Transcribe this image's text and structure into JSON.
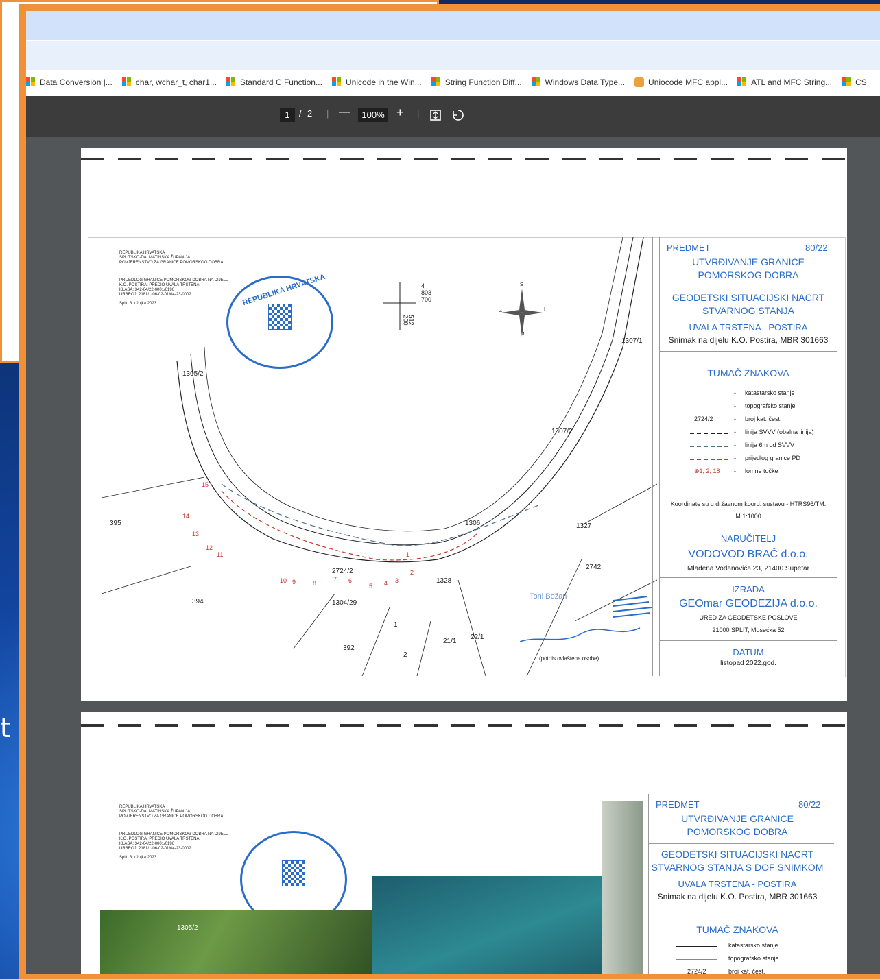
{
  "bookmarks": [
    {
      "label": "Data Conversion |...",
      "icon": "ms-logo"
    },
    {
      "label": "char, wchar_t, char1...",
      "icon": "ms-logo"
    },
    {
      "label": "Standard C Function...",
      "icon": "ms-logo"
    },
    {
      "label": "Unicode in the Win...",
      "icon": "ms-logo"
    },
    {
      "label": "String Function Diff...",
      "icon": "ms-logo"
    },
    {
      "label": "Windows Data Type...",
      "icon": "ms-logo"
    },
    {
      "label": "Uniocode MFC appl...",
      "icon": "site-icon"
    },
    {
      "label": "ATL and MFC String...",
      "icon": "ms-logo"
    },
    {
      "label": "CS",
      "icon": "ms-logo"
    }
  ],
  "pdf_toolbar": {
    "current_page": "1",
    "page_sep": "/",
    "total_pages": "2",
    "zoom": "100%",
    "minus": "—",
    "plus": "+"
  },
  "background_text": "t",
  "page1": {
    "header_left": [
      "REPUBLIKA HRVATSKA",
      "SPLITSKO-DALMATINSKA ŽUPANIJA",
      "POVJERENSTVO ZA GRANICE POMORSKOG DOBRA"
    ],
    "header_prop": [
      "PRIJEDLOG GRANICE POMORSKOG DOBRA NA DIJELU",
      "K.O. POSTIRA, PREDIO UVALA TRSTENA"
    ],
    "klasa": "KLASA: 342-04/22-0001/0196",
    "urbroj": "URBROJ: 2181/1-06-02-01/04-23-0002",
    "date_place": "Split, 3. ožujka 2023.",
    "stamp_text": "REPUBLIKA HRVATSKA",
    "coord_top": "4",
    "coord_a": "803",
    "coord_b": "700",
    "coord_c": "512",
    "coord_d": "200",
    "predmet": "PREDMET",
    "predmet_no": "80/22",
    "title1": "UTVRĐIVANJE GRANICE",
    "title2": "POMORSKOG DOBRA",
    "title3": "GEODETSKI SITUACIJSKI NACRT",
    "title4": "STVARNOG STANJA",
    "place": "UVALA TRSTENA - POSTIRA",
    "snimak": "Snimak na dijelu K.O. Postira, MBR 301663",
    "tumac": "TUMAČ ZNAKOVA",
    "legend": [
      {
        "label": "katastarsko stanje",
        "key": "",
        "color": "#222222",
        "style": "solid"
      },
      {
        "label": "topografsko stanje",
        "key": "",
        "color": "#888888",
        "style": "solid"
      },
      {
        "label": "broj kat. čest.",
        "key": "2724/2",
        "color": "",
        "style": "text"
      },
      {
        "label": "linija SVVV (obalna linija)",
        "key": "",
        "color": "#222222",
        "style": "dashed"
      },
      {
        "label": "linija 6m od SVVV",
        "key": "",
        "color": "#4a6f8a",
        "style": "dashed"
      },
      {
        "label": "prijedlog granice PD",
        "key": "",
        "color": "#c0392b",
        "style": "dashed"
      },
      {
        "label": "lomne točke",
        "key": "⊕1, 2, 18",
        "color": "#c0392b",
        "style": "text"
      }
    ],
    "koord": "Koordinate su u državnom koord. sustavu - HTRS96/TM.",
    "scale": "M 1:1000",
    "narucitelj": "NARUČITELJ",
    "vodovod": "VODOVOD BRAČ d.o.o.",
    "vod_addr": "Mladena Vodanovića 23, 21400 Supetar",
    "izrada": "IZRADA",
    "geomar": "GEOmar GEODEZIJA d.o.o.",
    "ured": "URED ZA GEODETSKE POSLOVE",
    "geo_addr": "21000 SPLIT, Mosećka 52",
    "datum": "DATUM",
    "datum_val": "listopad 2022.god.",
    "signer": "Toni Božan",
    "signature_caption": "(potpis ovlaštene osobe)",
    "parcels": [
      "1305/2",
      "1307/1",
      "1307/2",
      "2724/2",
      "1306",
      "1327",
      "2742",
      "395",
      "394",
      "1304/29",
      "1328",
      "1",
      "2",
      "392",
      "21/1",
      "22/1"
    ],
    "points": [
      "1",
      "2",
      "3",
      "4",
      "5",
      "6",
      "7",
      "8",
      "9",
      "10",
      "11",
      "12",
      "13",
      "14",
      "15"
    ],
    "compass": [
      "S",
      "I",
      "J",
      "Z"
    ]
  },
  "page2": {
    "header_left": [
      "REPUBLIKA HRVATSKA",
      "SPLITSKO-DALMATINSKA ŽUPANIJA",
      "POVJERENSTVO ZA GRANICE POMORSKOG DOBRA"
    ],
    "header_prop": [
      "PRIJEDLOG GRANICE POMORSKOG DOBRA NA DIJELU",
      "K.O. POSTIRA, PREDIO UVALA TRSTENA"
    ],
    "klasa": "KLASA: 342-04/22-0001/0196",
    "urbroj": "URBROJ: 2181/1-06-02-01/04-23-0002",
    "date_place": "Split, 3. ožujka 2023.",
    "predmet": "PREDMET",
    "predmet_no": "80/22",
    "title1": "UTVRĐIVANJE GRANICE",
    "title2": "POMORSKOG DOBRA",
    "title3": "GEODETSKI SITUACIJSKI NACRT",
    "title4": "STVARNOG STANJA S DOF SNIMKOM",
    "place": "UVALA TRSTENA - POSTIRA",
    "snimak": "Snimak na dijelu K.O. Postira, MBR 301663",
    "tumac": "TUMAČ ZNAKOVA",
    "legend": [
      {
        "label": "katastarsko stanje",
        "key": ""
      },
      {
        "label": "topografsko stanje",
        "key": ""
      },
      {
        "label": "broj kat. čest.",
        "key": "2724/2"
      }
    ],
    "parcel": "1305/2"
  },
  "colors": {
    "accent": "#f0913a",
    "pdf_toolbar": "#3c3c3c",
    "viewer_bg": "#525659",
    "doc_blue": "#2a6cc9",
    "boundary_red": "#c0392b"
  }
}
